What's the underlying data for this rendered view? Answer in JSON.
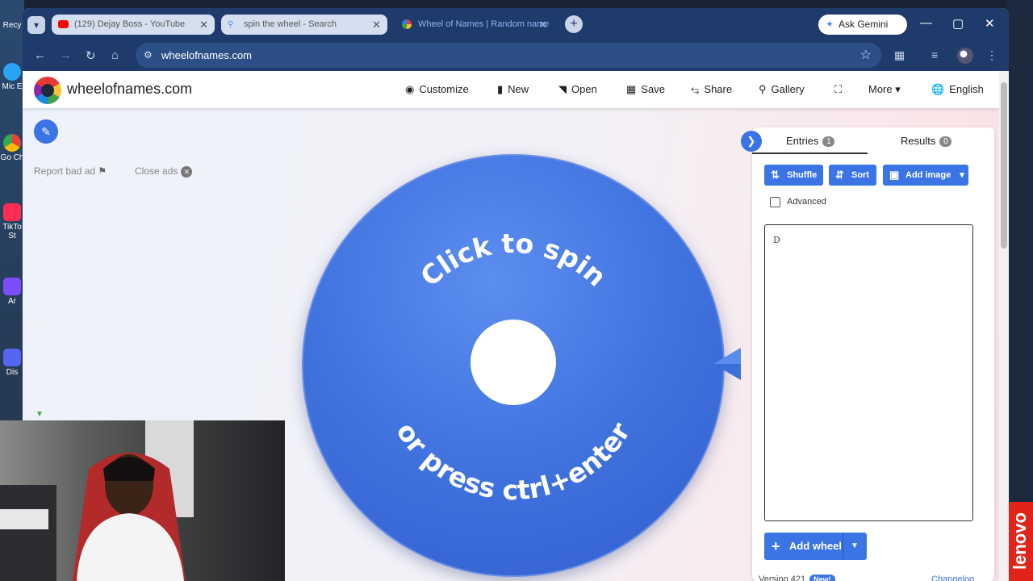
{
  "desktop": {
    "items": [
      {
        "label": "Recy",
        "color": "#7aa7e0"
      },
      {
        "label": "Mic E",
        "color": "#2aa4f4"
      },
      {
        "label": "Go Ch",
        "color": "#34a853"
      },
      {
        "label": "TikTo St",
        "color": "#ff2d55"
      },
      {
        "label": "Ar",
        "color": "#7c4dff"
      },
      {
        "label": "Dis",
        "color": "#5865f2"
      }
    ],
    "brand": "lenovo"
  },
  "browser": {
    "tabs": [
      {
        "title": "(129) Dejay Boss - YouTube",
        "icon": "youtube-icon",
        "color": "#ff0000"
      },
      {
        "title": "spin the wheel - Search",
        "icon": "search-icon",
        "color": "#4a8af4"
      },
      {
        "title": "Wheel of Names | Random name",
        "icon": "wheel-icon",
        "color": "#e53935"
      }
    ],
    "gemini_label": "Ask Gemini",
    "url": "wheelofnames.com"
  },
  "site": {
    "name": "wheelofnames.com",
    "menu": [
      {
        "icon": "palette-icon",
        "label": "Customize"
      },
      {
        "icon": "new-file-icon",
        "label": "New"
      },
      {
        "icon": "folder-open-icon",
        "label": "Open"
      },
      {
        "icon": "save-icon",
        "label": "Save"
      },
      {
        "icon": "share-icon",
        "label": "Share"
      },
      {
        "icon": "search-icon",
        "label": "Gallery"
      },
      {
        "icon": "fullscreen-icon",
        "label": ""
      },
      {
        "icon": "chevron-down-icon",
        "label": "More"
      },
      {
        "icon": "globe-icon",
        "label": "English"
      }
    ],
    "report_ad": "Report bad ad",
    "close_ads": "Close ads"
  },
  "wheel": {
    "top_text": "Click to spin",
    "bottom_text": "or press ctrl+enter",
    "color": "#4275e0"
  },
  "panel": {
    "tabs": [
      {
        "label": "Entries",
        "count": "1"
      },
      {
        "label": "Results",
        "count": "0"
      }
    ],
    "buttons": {
      "shuffle": "Shuffle",
      "sort": "Sort",
      "add_image": "Add image"
    },
    "advanced_label": "Advanced",
    "entries_text": "D",
    "add_wheel": "Add wheel",
    "version": "Version 421",
    "new_badge": "New!",
    "changelog": "Changelog"
  }
}
